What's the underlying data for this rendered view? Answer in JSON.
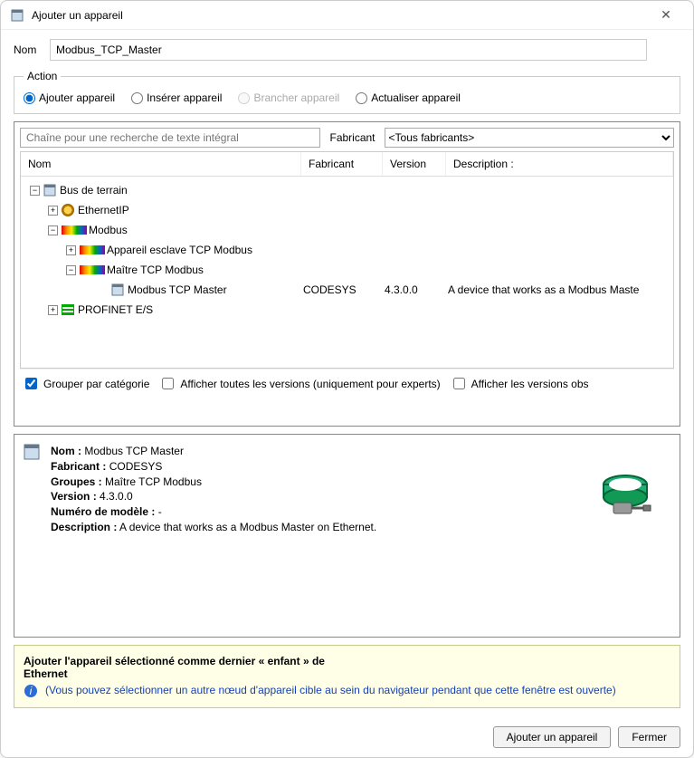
{
  "window": {
    "title": "Ajouter un appareil"
  },
  "name_field": {
    "label": "Nom",
    "value": "Modbus_TCP_Master"
  },
  "action": {
    "legend": "Action",
    "options": {
      "add": "Ajouter appareil",
      "insert": "Insérer appareil",
      "branch": "Brancher appareil",
      "update": "Actualiser appareil"
    },
    "selected": "add",
    "disabled": [
      "branch"
    ]
  },
  "search": {
    "placeholder": "Chaîne pour une recherche de texte intégral",
    "vendor_label": "Fabricant",
    "vendor_selected": "<Tous fabricants>"
  },
  "columns": {
    "name": "Nom",
    "vendor": "Fabricant",
    "version": "Version",
    "description": "Description :"
  },
  "tree": {
    "root": "Bus de terrain",
    "ethernetip": "EthernetIP",
    "modbus": "Modbus",
    "modbus_slave": "Appareil esclave TCP Modbus",
    "modbus_master_group": "Maître TCP Modbus",
    "modbus_master_device": {
      "name": "Modbus TCP Master",
      "vendor": "CODESYS",
      "version": "4.3.0.0",
      "description": "A device that works as a Modbus Maste"
    },
    "profinet": "PROFINET E/S"
  },
  "options": {
    "group_by_category": "Grouper par catégorie",
    "show_all_versions": "Afficher toutes les versions (uniquement pour experts)",
    "show_obsolete": "Afficher les versions obs"
  },
  "details": {
    "name_label": "Nom :",
    "name_value": "Modbus TCP Master",
    "vendor_label": "Fabricant :",
    "vendor_value": "CODESYS",
    "groups_label": "Groupes :",
    "groups_value": "Maître TCP Modbus",
    "version_label": "Version :",
    "version_value": "4.3.0.0",
    "model_label": "Numéro de modèle :",
    "model_value": "-",
    "desc_label": "Description :",
    "desc_value": "A device that works as a Modbus Master on Ethernet."
  },
  "hint": {
    "header_line1": "Ajouter l'appareil sélectionné comme dernier « enfant » de",
    "header_line2": "Ethernet",
    "body": "(Vous pouvez sélectionner un autre nœud d'appareil cible au sein du navigateur pendant que cette fenêtre est ouverte)"
  },
  "buttons": {
    "add": "Ajouter un appareil",
    "close": "Fermer"
  }
}
